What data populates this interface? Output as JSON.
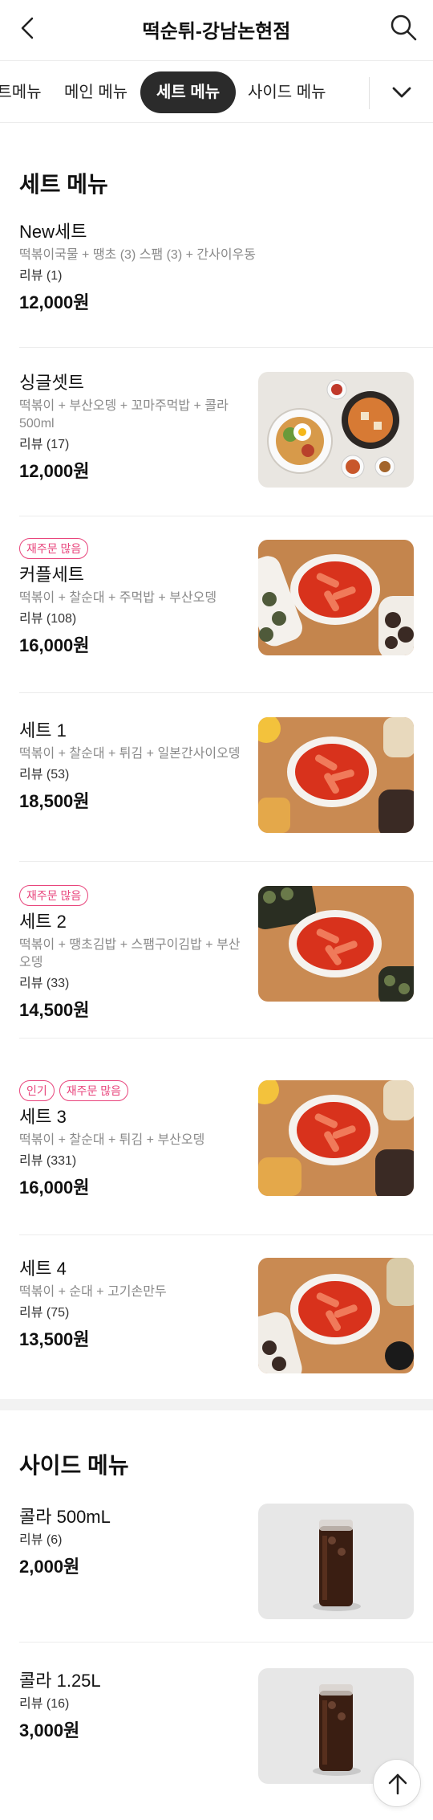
{
  "header": {
    "title": "떡순튀-강남논현점",
    "back_icon": "chevron-left-icon",
    "search_icon": "search-icon"
  },
  "tabs": [
    {
      "label": "세트메뉴"
    },
    {
      "label": "메인 메뉴"
    },
    {
      "label": "세트 메뉴",
      "active": true
    },
    {
      "label": "사이드 메뉴"
    }
  ],
  "tabs_more_icon": "chevron-down-icon",
  "colors": {
    "badge": "#e8457c",
    "active_tab": "#2b2b2b",
    "desc_text": "#8a8a8a"
  },
  "set_section": {
    "title": "세트 메뉴",
    "items": [
      {
        "name": "New세트",
        "desc": "떡볶이국물 + 땡초 (3) 스팸 (3) + 간사이우동",
        "review": "리뷰 (1)",
        "price": "12,000원",
        "badges": [],
        "image": ""
      },
      {
        "name": "싱글셋트",
        "desc": "떡볶이 + 부산오뎅 + 꼬마주먹밥 + 콜라 500ml",
        "review": "리뷰 (17)",
        "price": "12,000원",
        "badges": [],
        "image": "bibimbap-set-photo"
      },
      {
        "name": "커플세트",
        "desc": "떡볶이 + 찰순대 + 주먹밥 + 부산오뎅",
        "review": "리뷰 (108)",
        "price": "16,000원",
        "badges": [
          "재주문 많음"
        ],
        "image": "tteokbokki-photo"
      },
      {
        "name": "세트 1",
        "desc": "떡볶이 + 찰순대 + 튀김 + 일본간사이오뎅",
        "review": "리뷰 (53)",
        "price": "18,500원",
        "badges": [],
        "image": "tteokbokki-photo"
      },
      {
        "name": "세트 2",
        "desc": "떡볶이 + 땡초김밥 + 스팸구이김밥 + 부산오뎅",
        "review": "리뷰 (33)",
        "price": "14,500원",
        "badges": [
          "재주문 많음"
        ],
        "image": "tteokbokki-photo"
      },
      {
        "name": "세트 3",
        "desc": "떡볶이 + 찰순대 + 튀김 + 부산오뎅",
        "review": "리뷰 (331)",
        "price": "16,000원",
        "badges": [
          "인기",
          "재주문 많음"
        ],
        "image": "tteokbokki-photo"
      },
      {
        "name": "세트 4",
        "desc": "떡볶이 + 순대 + 고기손만두",
        "review": "리뷰 (75)",
        "price": "13,500원",
        "badges": [],
        "image": "tteokbokki-photo"
      }
    ]
  },
  "side_section": {
    "title": "사이드 메뉴",
    "items": [
      {
        "name": "콜라 500mL",
        "review": "리뷰 (6)",
        "price": "2,000원",
        "image": "cola-glass-photo"
      },
      {
        "name": "콜라 1.25L",
        "review": "리뷰 (16)",
        "price": "3,000원",
        "image": "cola-glass-photo"
      }
    ]
  },
  "scroll_top_icon": "arrow-up-icon"
}
